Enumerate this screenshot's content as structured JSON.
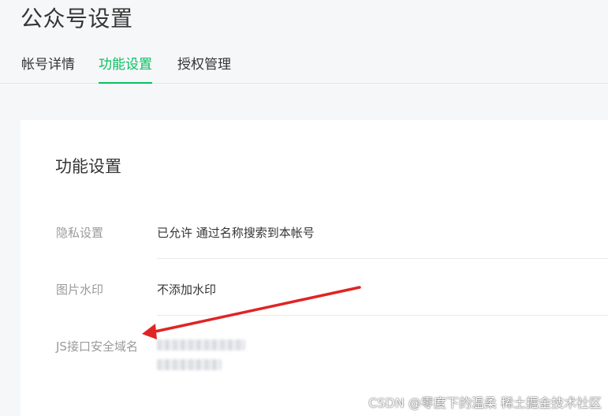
{
  "page": {
    "title": "公众号设置"
  },
  "tabs": [
    {
      "label": "帐号详情",
      "active": false
    },
    {
      "label": "功能设置",
      "active": true
    },
    {
      "label": "授权管理",
      "active": false
    }
  ],
  "card": {
    "title": "功能设置",
    "rows": [
      {
        "label": "隐私设置",
        "value": "已允许 通过名称搜索到本帐号"
      },
      {
        "label": "图片水印",
        "value": "不添加水印"
      },
      {
        "label": "JS接口安全域名",
        "value": ""
      }
    ]
  },
  "annotation": {
    "arrow_color": "#e02424",
    "target": "JS接口安全域名"
  },
  "colors": {
    "accent": "#07c160"
  },
  "watermark": "CSDN @零度下的温柔 稀土掘金技术社区"
}
